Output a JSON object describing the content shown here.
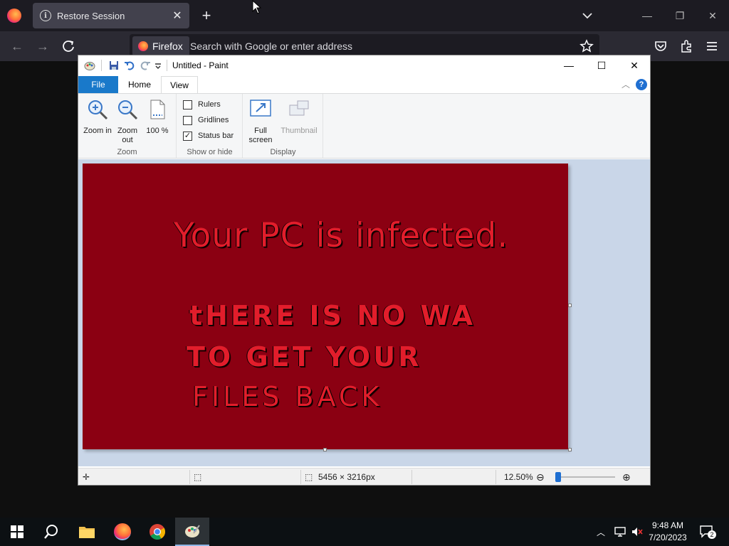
{
  "browser": {
    "tab_title": "Restore Session",
    "identity_label": "Firefox",
    "url_placeholder": "Search with Google or enter address"
  },
  "paint": {
    "window_title": "Untitled - Paint",
    "tabs": {
      "file": "File",
      "home": "Home",
      "view": "View"
    },
    "ribbon": {
      "zoom_group": {
        "label": "Zoom",
        "zoom_in": "Zoom in",
        "zoom_out": "Zoom out",
        "hundred": "100 %"
      },
      "show_hide_group": {
        "label": "Show or hide",
        "rulers": {
          "label": "Rulers",
          "checked": false
        },
        "gridlines": {
          "label": "Gridlines",
          "checked": false
        },
        "status_bar": {
          "label": "Status bar",
          "checked": true
        }
      },
      "display_group": {
        "label": "Display",
        "full_screen": "Full screen",
        "thumbnail": "Thumbnail"
      }
    },
    "image_text": {
      "line1": "Your PC is infected.",
      "line2": "tHERE IS NO WA",
      "line3": "TO GET YOUR",
      "line4": "FILES BACK"
    },
    "status": {
      "image_size": "5456 × 3216px",
      "zoom": "12.50%"
    },
    "colors": {
      "image_bg": "#8b0012",
      "text": "#e21d2b",
      "accent": "#1979ca"
    }
  },
  "taskbar": {
    "time": "9:48 AM",
    "date": "7/20/2023",
    "notification_count": "2"
  }
}
